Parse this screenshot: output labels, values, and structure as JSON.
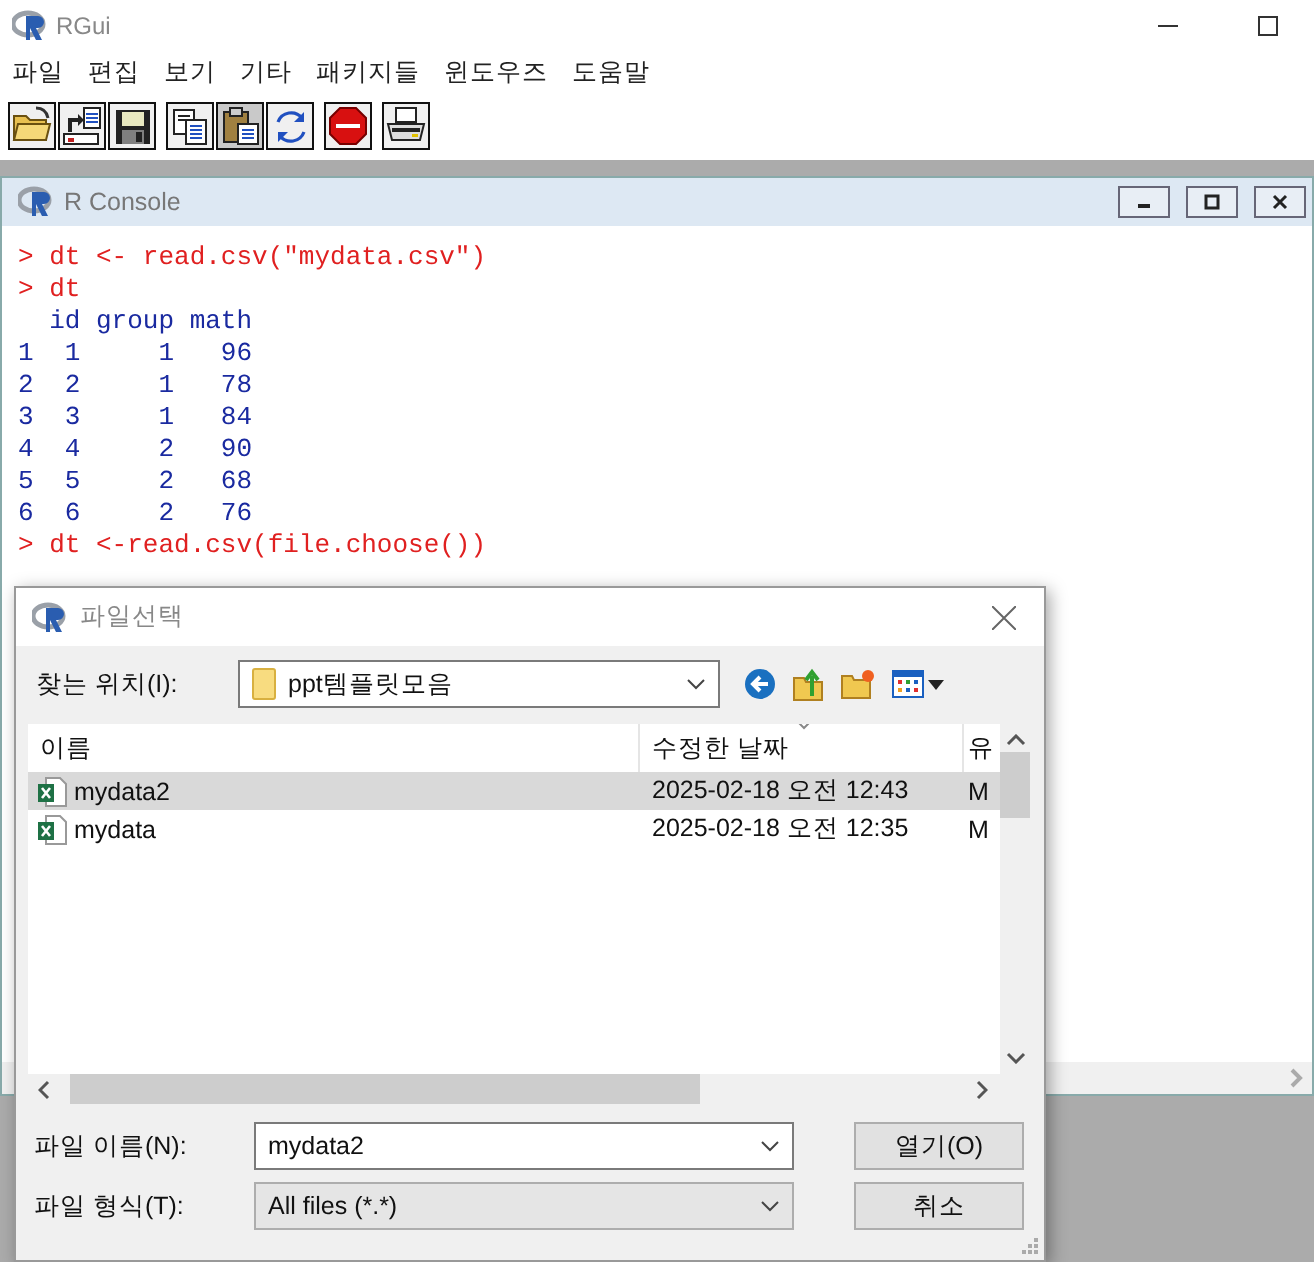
{
  "app": {
    "title": "RGui"
  },
  "menu": [
    "파일",
    "편집",
    "보기",
    "기타",
    "패키지들",
    "윈도우즈",
    "도움말"
  ],
  "toolbar_groups": [
    {
      "buttons": [
        {
          "kind": "open",
          "disabled": false
        },
        {
          "kind": "load",
          "disabled": false
        },
        {
          "kind": "save",
          "disabled": false
        }
      ]
    },
    {
      "buttons": [
        {
          "kind": "copy",
          "disabled": false
        },
        {
          "kind": "paste",
          "disabled": true
        },
        {
          "kind": "refresh",
          "disabled": false
        }
      ]
    },
    {
      "buttons": [
        {
          "kind": "stop",
          "disabled": false
        }
      ]
    },
    {
      "buttons": [
        {
          "kind": "print",
          "disabled": false
        }
      ]
    }
  ],
  "console": {
    "title": "R Console",
    "lines": [
      {
        "kind": "input",
        "text": "> dt <- read.csv(\"mydata.csv\")"
      },
      {
        "kind": "input",
        "text": "> dt"
      },
      {
        "kind": "output",
        "text": "  id group math"
      },
      {
        "kind": "output",
        "text": "1  1     1   96"
      },
      {
        "kind": "output",
        "text": "2  2     1   78"
      },
      {
        "kind": "output",
        "text": "3  3     1   84"
      },
      {
        "kind": "output",
        "text": "4  4     2   90"
      },
      {
        "kind": "output",
        "text": "5  5     2   68"
      },
      {
        "kind": "output",
        "text": "6  6     2   76"
      },
      {
        "kind": "input",
        "text": "> dt <-read.csv(file.choose())"
      }
    ]
  },
  "dialog": {
    "title": "파일선택",
    "look_in": {
      "label": "찾는 위치(I):",
      "value": "ppt템플릿모음"
    },
    "columns": [
      "이름",
      "수정한 날짜",
      "유"
    ],
    "files": [
      {
        "name": "mydata2",
        "modified": "2025-02-18 오전 12:43",
        "column_3": "M",
        "selected": true
      },
      {
        "name": "mydata",
        "modified": "2025-02-18 오전 12:35",
        "column_3": "M",
        "selected": false
      }
    ],
    "file_name": {
      "label": "파일 이름(N):",
      "value": "mydata2"
    },
    "file_type": {
      "label": "파일 형식(T):",
      "value": "All files (*.*)"
    },
    "buttons": [
      "열기(O)",
      "취소"
    ]
  }
}
